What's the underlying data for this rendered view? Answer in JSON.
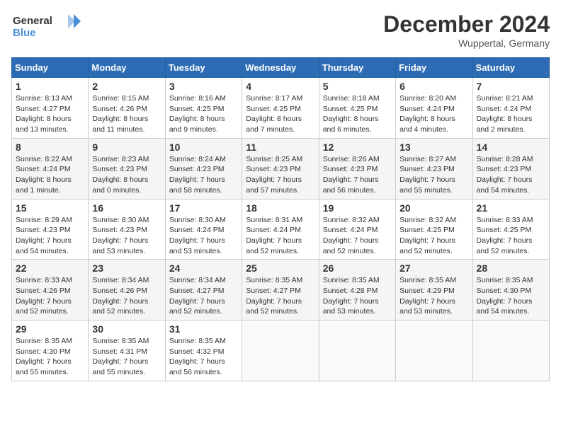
{
  "logo": {
    "general": "General",
    "blue": "Blue"
  },
  "title": "December 2024",
  "location": "Wuppertal, Germany",
  "weekdays": [
    "Sunday",
    "Monday",
    "Tuesday",
    "Wednesday",
    "Thursday",
    "Friday",
    "Saturday"
  ],
  "weeks": [
    [
      {
        "day": "1",
        "sunrise": "8:13 AM",
        "sunset": "4:27 PM",
        "daylight": "8 hours and 13 minutes."
      },
      {
        "day": "2",
        "sunrise": "8:15 AM",
        "sunset": "4:26 PM",
        "daylight": "8 hours and 11 minutes."
      },
      {
        "day": "3",
        "sunrise": "8:16 AM",
        "sunset": "4:25 PM",
        "daylight": "8 hours and 9 minutes."
      },
      {
        "day": "4",
        "sunrise": "8:17 AM",
        "sunset": "4:25 PM",
        "daylight": "8 hours and 7 minutes."
      },
      {
        "day": "5",
        "sunrise": "8:18 AM",
        "sunset": "4:25 PM",
        "daylight": "8 hours and 6 minutes."
      },
      {
        "day": "6",
        "sunrise": "8:20 AM",
        "sunset": "4:24 PM",
        "daylight": "8 hours and 4 minutes."
      },
      {
        "day": "7",
        "sunrise": "8:21 AM",
        "sunset": "4:24 PM",
        "daylight": "8 hours and 2 minutes."
      }
    ],
    [
      {
        "day": "8",
        "sunrise": "8:22 AM",
        "sunset": "4:24 PM",
        "daylight": "8 hours and 1 minute."
      },
      {
        "day": "9",
        "sunrise": "8:23 AM",
        "sunset": "4:23 PM",
        "daylight": "8 hours and 0 minutes."
      },
      {
        "day": "10",
        "sunrise": "8:24 AM",
        "sunset": "4:23 PM",
        "daylight": "7 hours and 58 minutes."
      },
      {
        "day": "11",
        "sunrise": "8:25 AM",
        "sunset": "4:23 PM",
        "daylight": "7 hours and 57 minutes."
      },
      {
        "day": "12",
        "sunrise": "8:26 AM",
        "sunset": "4:23 PM",
        "daylight": "7 hours and 56 minutes."
      },
      {
        "day": "13",
        "sunrise": "8:27 AM",
        "sunset": "4:23 PM",
        "daylight": "7 hours and 55 minutes."
      },
      {
        "day": "14",
        "sunrise": "8:28 AM",
        "sunset": "4:23 PM",
        "daylight": "7 hours and 54 minutes."
      }
    ],
    [
      {
        "day": "15",
        "sunrise": "8:29 AM",
        "sunset": "4:23 PM",
        "daylight": "7 hours and 54 minutes."
      },
      {
        "day": "16",
        "sunrise": "8:30 AM",
        "sunset": "4:23 PM",
        "daylight": "7 hours and 53 minutes."
      },
      {
        "day": "17",
        "sunrise": "8:30 AM",
        "sunset": "4:24 PM",
        "daylight": "7 hours and 53 minutes."
      },
      {
        "day": "18",
        "sunrise": "8:31 AM",
        "sunset": "4:24 PM",
        "daylight": "7 hours and 52 minutes."
      },
      {
        "day": "19",
        "sunrise": "8:32 AM",
        "sunset": "4:24 PM",
        "daylight": "7 hours and 52 minutes."
      },
      {
        "day": "20",
        "sunrise": "8:32 AM",
        "sunset": "4:25 PM",
        "daylight": "7 hours and 52 minutes."
      },
      {
        "day": "21",
        "sunrise": "8:33 AM",
        "sunset": "4:25 PM",
        "daylight": "7 hours and 52 minutes."
      }
    ],
    [
      {
        "day": "22",
        "sunrise": "8:33 AM",
        "sunset": "4:26 PM",
        "daylight": "7 hours and 52 minutes."
      },
      {
        "day": "23",
        "sunrise": "8:34 AM",
        "sunset": "4:26 PM",
        "daylight": "7 hours and 52 minutes."
      },
      {
        "day": "24",
        "sunrise": "8:34 AM",
        "sunset": "4:27 PM",
        "daylight": "7 hours and 52 minutes."
      },
      {
        "day": "25",
        "sunrise": "8:35 AM",
        "sunset": "4:27 PM",
        "daylight": "7 hours and 52 minutes."
      },
      {
        "day": "26",
        "sunrise": "8:35 AM",
        "sunset": "4:28 PM",
        "daylight": "7 hours and 53 minutes."
      },
      {
        "day": "27",
        "sunrise": "8:35 AM",
        "sunset": "4:29 PM",
        "daylight": "7 hours and 53 minutes."
      },
      {
        "day": "28",
        "sunrise": "8:35 AM",
        "sunset": "4:30 PM",
        "daylight": "7 hours and 54 minutes."
      }
    ],
    [
      {
        "day": "29",
        "sunrise": "8:35 AM",
        "sunset": "4:30 PM",
        "daylight": "7 hours and 55 minutes."
      },
      {
        "day": "30",
        "sunrise": "8:35 AM",
        "sunset": "4:31 PM",
        "daylight": "7 hours and 55 minutes."
      },
      {
        "day": "31",
        "sunrise": "8:35 AM",
        "sunset": "4:32 PM",
        "daylight": "7 hours and 56 minutes."
      },
      null,
      null,
      null,
      null
    ]
  ],
  "labels": {
    "sunrise": "Sunrise:",
    "sunset": "Sunset:",
    "daylight": "Daylight:"
  }
}
